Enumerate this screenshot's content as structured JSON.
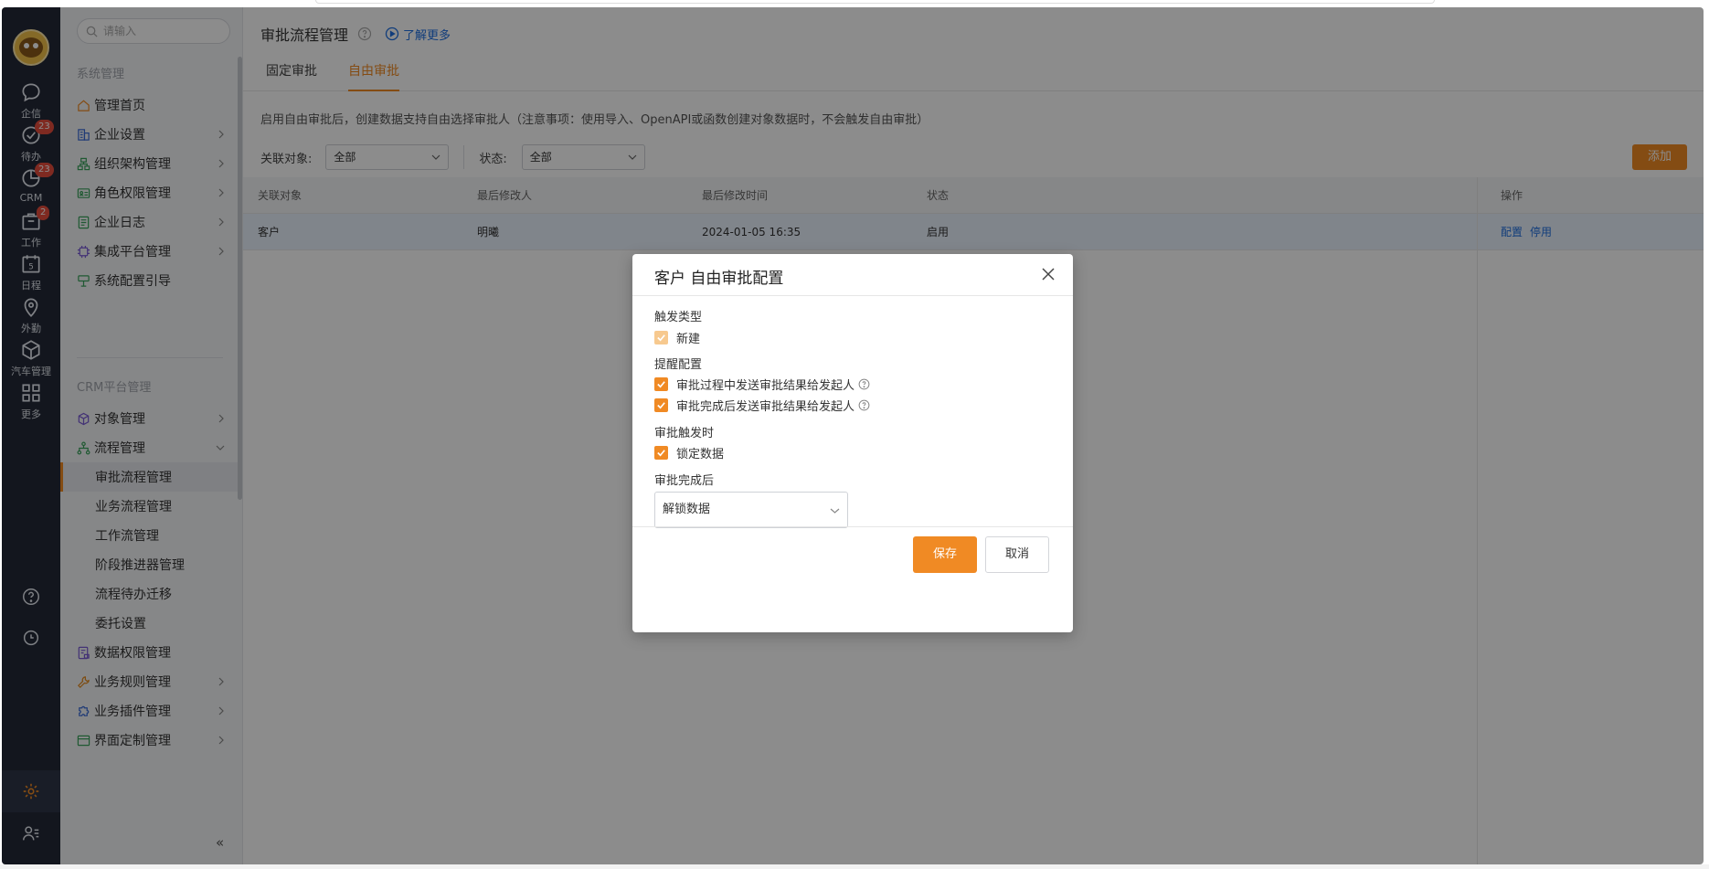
{
  "rail": {
    "items": [
      {
        "label": "企信",
        "icon": "chat-bubble-icon"
      },
      {
        "label": "待办",
        "icon": "check-circle-icon",
        "badge": "23"
      },
      {
        "label": "CRM",
        "icon": "pie-chart-icon",
        "badge": "23"
      },
      {
        "label": "工作",
        "icon": "briefcase-icon",
        "badge": "2"
      },
      {
        "label": "日程",
        "icon": "calendar-icon",
        "day": "5"
      },
      {
        "label": "外勤",
        "icon": "location-pin-icon"
      },
      {
        "label": "汽车管理",
        "icon": "cube-icon"
      },
      {
        "label": "更多",
        "icon": "grid-icon"
      }
    ]
  },
  "sidebar": {
    "search_placeholder": "请输入",
    "group1": "系统管理",
    "items1": [
      {
        "label": "管理首页",
        "icon": "home-icon"
      },
      {
        "label": "企业设置",
        "icon": "building-icon"
      },
      {
        "label": "组织架构管理",
        "icon": "org-chart-icon"
      },
      {
        "label": "角色权限管理",
        "icon": "id-card-icon"
      },
      {
        "label": "企业日志",
        "icon": "log-icon"
      },
      {
        "label": "集成平台管理",
        "icon": "chip-icon"
      },
      {
        "label": "系统配置引导",
        "icon": "guide-icon"
      }
    ],
    "group2": "CRM平台管理",
    "items2": [
      {
        "label": "对象管理",
        "icon": "object-icon"
      },
      {
        "label": "流程管理",
        "icon": "flow-icon"
      },
      {
        "label": "审批流程管理"
      },
      {
        "label": "业务流程管理"
      },
      {
        "label": "工作流管理"
      },
      {
        "label": "阶段推进器管理"
      },
      {
        "label": "流程待办迁移"
      },
      {
        "label": "委托设置"
      },
      {
        "label": "数据权限管理",
        "icon": "data-lock-icon"
      },
      {
        "label": "业务规则管理",
        "icon": "wrench-icon"
      },
      {
        "label": "业务插件管理",
        "icon": "puzzle-icon"
      },
      {
        "label": "界面定制管理",
        "icon": "layout-icon"
      }
    ],
    "collapse": "«"
  },
  "page": {
    "title": "审批流程管理",
    "learn_more": "了解更多",
    "tabs": [
      "固定审批",
      "自由审批"
    ],
    "notice": "启用自由审批后，创建数据支持自由选择审批人（注意事项：使用导入、OpenAPI或函数创建对象数据时，不会触发自由审批）",
    "filter_object_label": "关联对象:",
    "filter_object_value": "全部",
    "filter_status_label": "状态:",
    "filter_status_value": "全部",
    "add_button": "添加",
    "table": {
      "columns": [
        "关联对象",
        "最后修改人",
        "最后修改时间",
        "状态",
        "操作"
      ],
      "rows": [
        {
          "object": "客户",
          "modifier": "明曦",
          "time": "2024-01-05 16:35",
          "status": "启用",
          "actions": [
            "配置",
            "停用"
          ]
        }
      ]
    }
  },
  "dialog": {
    "title": "客户 自由审批配置",
    "trigger_label": "触发类型",
    "trigger_new": "新建",
    "remind_label": "提醒配置",
    "remind_1": "审批过程中发送审批结果给发起人",
    "remind_2": "审批完成后发送审批结果给发起人",
    "on_trigger_label": "审批触发时",
    "lock_data": "锁定数据",
    "after_label": "审批完成后",
    "after_value": "解锁数据",
    "save": "保存",
    "cancel": "取消"
  },
  "colors": {
    "accent": "#f08a24",
    "link": "#1f6fe0",
    "rail": "#232838"
  }
}
